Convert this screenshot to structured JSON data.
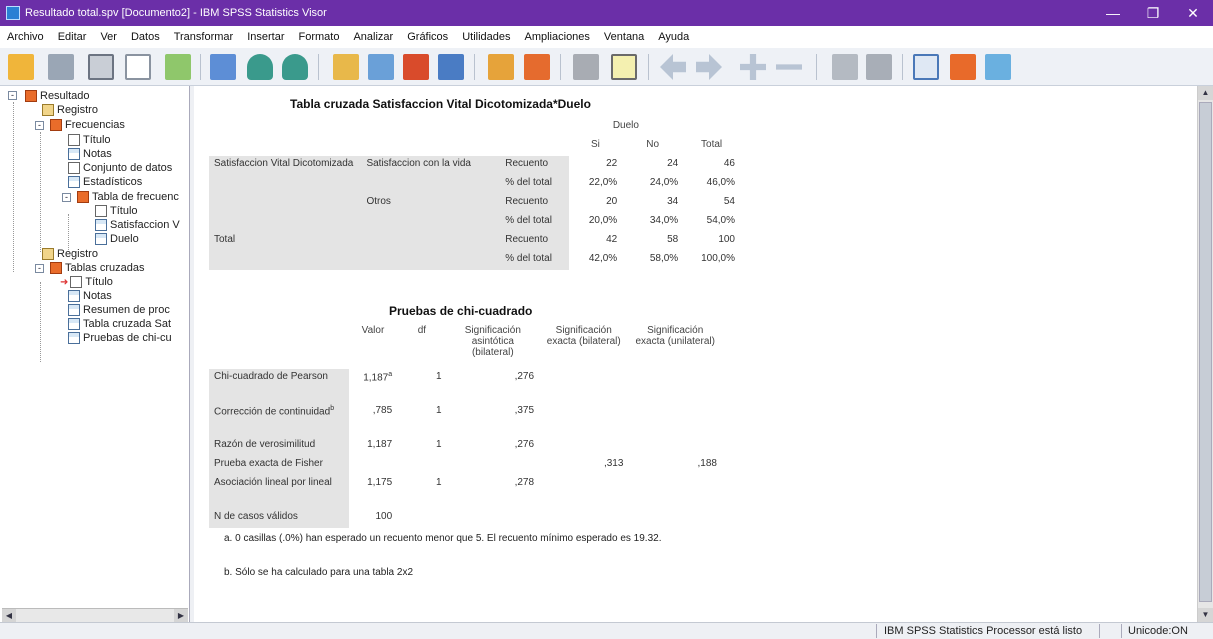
{
  "window": {
    "title": "Resultado total.spv [Documento2] - IBM SPSS Statistics Visor",
    "minimize": "—",
    "restore": "❐",
    "close": "✕"
  },
  "menu": [
    "Archivo",
    "Editar",
    "Ver",
    "Datos",
    "Transformar",
    "Insertar",
    "Formato",
    "Analizar",
    "Gráficos",
    "Utilidades",
    "Ampliaciones",
    "Ventana",
    "Ayuda"
  ],
  "toolbar_icons": [
    "open-icon",
    "save-icon",
    "print-icon",
    "print-preview-icon",
    "export-icon",
    "recall-dialog-icon",
    "undo-icon",
    "redo-icon",
    "goto-data-icon",
    "goto-variable-icon",
    "variables-icon",
    "insert-cases-icon",
    "select-cases-icon",
    "weight-icon",
    "show-hide-icon",
    "designate-window-icon",
    "promote-icon",
    "demote-icon",
    "expand-icon",
    "collapse-icon",
    "show-icon",
    "hide-icon",
    "insert-heading-icon",
    "insert-title-icon",
    "insert-text-icon"
  ],
  "nav": {
    "root": "Resultado",
    "registro": "Registro",
    "frecuencias": "Frecuencias",
    "titulo": "Título",
    "notas": "Notas",
    "conjunto": "Conjunto de datos",
    "estadisticos": "Estadísticos",
    "tabla_frec": "Tabla de frecuenc",
    "tf_titulo": "Título",
    "tf_satis": "Satisfaccion V",
    "tf_duelo": "Duelo",
    "registro2": "Registro",
    "tablas": "Tablas cruzadas",
    "tc_titulo": "Título",
    "tc_notas": "Notas",
    "tc_resumen": "Resumen de proc",
    "tc_tabla": "Tabla cruzada Sat",
    "tc_pruebas": "Pruebas de chi-cu"
  },
  "crosstab": {
    "title": "Tabla cruzada Satisfaccion Vital Dicotomizada*Duelo",
    "col_group": "Duelo",
    "cols": [
      "Si",
      "No",
      "Total"
    ],
    "row_var": "Satisfaccion Vital Dicotomizada",
    "rows": [
      {
        "group": "Satisfaccion con la vida",
        "stat": "Recuento",
        "values": [
          "22",
          "24",
          "46"
        ]
      },
      {
        "group": "",
        "stat": "% del total",
        "values": [
          "22,0%",
          "24,0%",
          "46,0%"
        ]
      },
      {
        "group": "Otros",
        "stat": "Recuento",
        "values": [
          "20",
          "34",
          "54"
        ]
      },
      {
        "group": "",
        "stat": "% del total",
        "values": [
          "20,0%",
          "34,0%",
          "54,0%"
        ]
      }
    ],
    "total": {
      "label": "Total",
      "rows": [
        {
          "stat": "Recuento",
          "values": [
            "42",
            "58",
            "100"
          ]
        },
        {
          "stat": "% del total",
          "values": [
            "42,0%",
            "58,0%",
            "100,0%"
          ]
        }
      ]
    }
  },
  "chisq": {
    "title": "Pruebas de chi-cuadrado",
    "headers": [
      "Valor",
      "df",
      "Significación asintótica (bilateral)",
      "Significación exacta (bilateral)",
      "Significación exacta (unilateral)"
    ],
    "rows": [
      {
        "label": "Chi-cuadrado de Pearson",
        "sup": "",
        "values": [
          "1,187",
          "1",
          ",276",
          "",
          ""
        ],
        "value_sup": "a"
      },
      {
        "label": "Corrección de continuidad",
        "sup": "b",
        "values": [
          ",785",
          "1",
          ",375",
          "",
          ""
        ],
        "value_sup": ""
      },
      {
        "label": "Razón de verosimilitud",
        "sup": "",
        "values": [
          "1,187",
          "1",
          ",276",
          "",
          ""
        ],
        "value_sup": ""
      },
      {
        "label": "Prueba exacta de Fisher",
        "sup": "",
        "values": [
          "",
          "",
          "",
          ",313",
          ",188"
        ],
        "value_sup": ""
      },
      {
        "label": "Asociación lineal por lineal",
        "sup": "",
        "values": [
          "1,175",
          "1",
          ",278",
          "",
          ""
        ],
        "value_sup": ""
      },
      {
        "label": "N de casos válidos",
        "sup": "",
        "values": [
          "100",
          "",
          "",
          "",
          ""
        ],
        "value_sup": ""
      }
    ],
    "footnote_a": "a. 0 casillas (.0%) han esperado un recuento menor que 5. El recuento mínimo esperado es 19.32.",
    "footnote_b": "b. Sólo se ha calculado para una tabla 2x2"
  },
  "status": {
    "processor": "IBM SPSS Statistics Processor está listo",
    "unicode": "Unicode:ON"
  }
}
